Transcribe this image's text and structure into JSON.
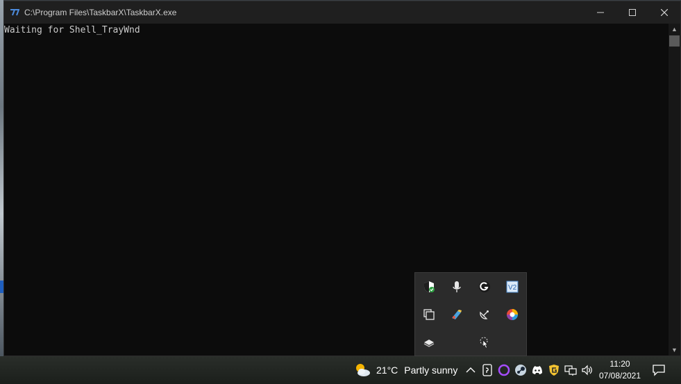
{
  "window": {
    "title": "C:\\Program Files\\TaskbarX\\TaskbarX.exe",
    "minimize_glyph": "—",
    "maximize_glyph": "☐",
    "close_glyph": "✕"
  },
  "console": {
    "lines": [
      "Waiting for Shell_TrayWnd"
    ]
  },
  "scrollbar": {
    "up_glyph": "▲",
    "down_glyph": "▼"
  },
  "tray_flyout": {
    "icons": [
      "windows-security-icon",
      "microphone-icon",
      "logitech-g-icon",
      "v2-app-icon",
      "copy-windows-icon",
      "paint-brush-app-icon",
      "satellite-dish-icon",
      "color-picker-icon",
      "layers-stack-icon",
      "touch-cursor-icon"
    ]
  },
  "taskbar": {
    "weather": {
      "icon": "partly-sunny-icon",
      "temperature": "21°C",
      "condition": "Partly sunny"
    },
    "tray_icons": [
      "chevron-up-icon",
      "phone-link-icon",
      "circle-app-icon",
      "steam-icon",
      "discord-icon",
      "shield-g-icon",
      "network-icon",
      "volume-icon"
    ],
    "clock": {
      "time": "11:20",
      "date": "07/08/2021"
    },
    "notifications_icon": "action-center-icon"
  },
  "colors": {
    "console_bg": "#0c0c0c",
    "console_text": "#cccccc",
    "titlebar_bg": "#1f1f1f",
    "flyout_bg": "#2b2b2b"
  }
}
